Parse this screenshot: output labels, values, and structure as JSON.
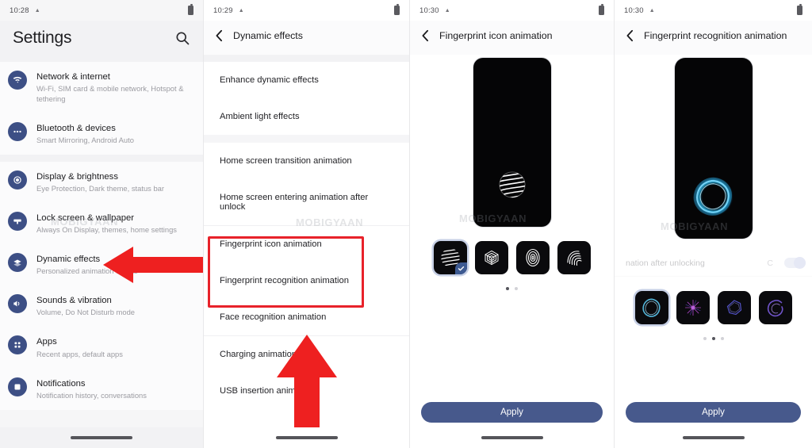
{
  "panels": [
    {
      "id": "settings-home",
      "status": {
        "time": "10:28",
        "battery_icon": "battery-icon",
        "warning_icon": "warning-triangle-icon"
      },
      "header": {
        "title": "Settings",
        "search_icon": "search-icon"
      },
      "groups": [
        {
          "items": [
            {
              "icon": "wifi-icon",
              "title": "Network & internet",
              "subtitle": "Wi-Fi, SIM card & mobile network, Hotspot & tethering"
            },
            {
              "icon": "bluetooth-devices-icon",
              "title": "Bluetooth & devices",
              "subtitle": "Smart Mirroring, Android Auto"
            }
          ]
        },
        {
          "items": [
            {
              "icon": "display-brightness-icon",
              "title": "Display & brightness",
              "subtitle": "Eye Protection, Dark theme, status bar"
            },
            {
              "icon": "lock-screen-icon",
              "title": "Lock screen & wallpaper",
              "subtitle": "Always On Display, themes, home settings"
            },
            {
              "icon": "dynamic-effects-icon",
              "title": "Dynamic effects",
              "subtitle": "Personalized animation effects"
            },
            {
              "icon": "sounds-vibration-icon",
              "title": "Sounds & vibration",
              "subtitle": "Volume, Do Not Disturb mode"
            },
            {
              "icon": "apps-icon",
              "title": "Apps",
              "subtitle": "Recent apps, default apps"
            },
            {
              "icon": "notifications-icon",
              "title": "Notifications",
              "subtitle": "Notification history, conversations"
            }
          ]
        }
      ],
      "watermark": "MOBIGYAAN",
      "annotation": {
        "type": "arrow-left",
        "color": "#e8222a",
        "points_to": "Dynamic effects"
      }
    },
    {
      "id": "dynamic-effects",
      "status": {
        "time": "10:29"
      },
      "header": {
        "title": "Dynamic effects",
        "back_icon": "back-chevron-icon"
      },
      "sections": [
        {
          "rows": [
            "Enhance dynamic effects",
            "Ambient light effects"
          ]
        },
        {
          "rows": [
            "Home screen transition animation",
            "Home screen entering animation after unlock"
          ]
        },
        {
          "rows": [
            "Fingerprint icon animation",
            "Fingerprint recognition animation",
            "Face recognition animation"
          ]
        },
        {
          "rows": [
            "Charging animation",
            "USB insertion animation"
          ]
        }
      ],
      "watermark": "MOBIGYAAN",
      "annotations": {
        "red_box_color": "#e8222a",
        "red_box_rows": [
          "Fingerprint icon animation",
          "Fingerprint recognition animation"
        ],
        "arrow_up_color": "#e8222a"
      }
    },
    {
      "id": "fingerprint-icon-animation",
      "status": {
        "time": "10:30"
      },
      "header": {
        "title": "Fingerprint icon animation",
        "back_icon": "back-chevron-icon"
      },
      "preview": {
        "art": "striped-sphere-fingerprint"
      },
      "thumbnails": [
        {
          "name": "striped-sphere",
          "selected": true
        },
        {
          "name": "hex-layers",
          "selected": false
        },
        {
          "name": "oval-fingerprint",
          "selected": false
        },
        {
          "name": "arc-fingerprint",
          "selected": false
        }
      ],
      "pager": {
        "count": 2,
        "active": 0
      },
      "apply_label": "Apply",
      "watermark": "MOBIGYAAN"
    },
    {
      "id": "fingerprint-recognition-animation",
      "status": {
        "time": "10:30"
      },
      "header": {
        "title": "Fingerprint recognition animation",
        "back_icon": "back-chevron-icon"
      },
      "preview": {
        "art": "blue-energy-ring"
      },
      "faded_row": {
        "label": "nation after unlocking",
        "value": "C",
        "toggle_on": true
      },
      "thumbnails": [
        {
          "name": "blue-ring",
          "selected": true
        },
        {
          "name": "purple-burst",
          "selected": false
        },
        {
          "name": "indigo-hexring",
          "selected": false
        },
        {
          "name": "violet-swirl",
          "selected": false
        }
      ],
      "pager": {
        "count": 3,
        "active": 1
      },
      "apply_label": "Apply",
      "watermark": "MOBIGYAAN"
    }
  ]
}
